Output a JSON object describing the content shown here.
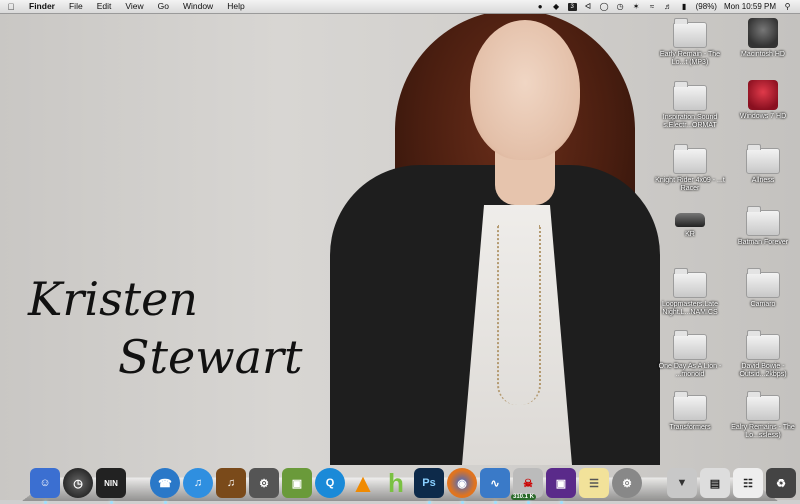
{
  "menubar": {
    "app_name": "Finder",
    "menus": [
      "File",
      "Edit",
      "View",
      "Go",
      "Window",
      "Help"
    ],
    "status": {
      "box_icon_text": "3",
      "battery": "(98%)",
      "clock": "Mon 10:59 PM"
    }
  },
  "wallpaper": {
    "line1": "Kristen",
    "line2": "Stewart"
  },
  "desktop": {
    "col_left": [
      {
        "label": "Early Remain - The Lo...t (MP3)"
      },
      {
        "label": "Inspiration.Sound s.Electr...ORMAT"
      },
      {
        "label": "Knight Rider 4x09 - ...t Racer"
      },
      {
        "label": "KR"
      },
      {
        "label": "Loopmasters.Late Night.L...NAMICS"
      },
      {
        "label": "One Day As A Lion - ...monoid"
      },
      {
        "label": "Transformers"
      }
    ],
    "col_right": [
      {
        "label": "Macintosh HD"
      },
      {
        "label": "Windows 7 HD"
      },
      {
        "label": "Allness"
      },
      {
        "label": "Batman Forever"
      },
      {
        "label": "Camaro"
      },
      {
        "label": "David Bowie - Outsid...2kbps)"
      },
      {
        "label": "Ealry Remains - The Lo...ssless)"
      }
    ]
  },
  "dock": {
    "activity_badge": "310.1 K",
    "photoshop_text": "Ps",
    "hulu_text": "h",
    "nin_text": "NIN",
    "colors": {
      "finder": "#3b6fd1",
      "itunes": "#2f8fe0",
      "photoshop": "#0d2a4a",
      "firefox": "#e0741f",
      "vlc": "#f08a00"
    }
  }
}
